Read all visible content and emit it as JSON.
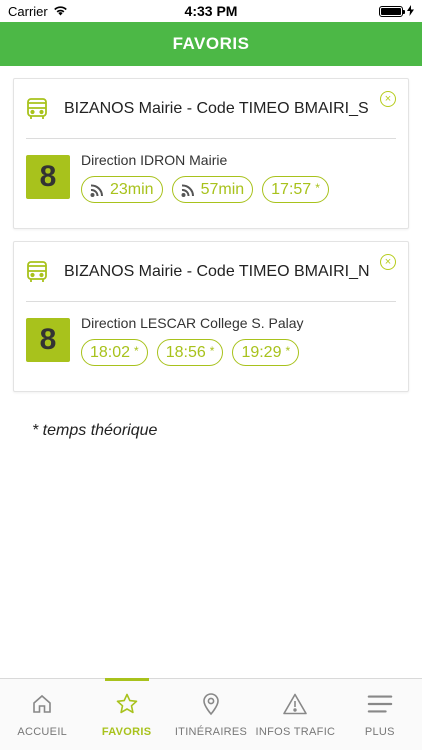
{
  "status_bar": {
    "carrier": "Carrier",
    "time": "4:33 PM",
    "battery_level": 1.0
  },
  "header": {
    "title": "FAVORIS"
  },
  "favorites": [
    {
      "stop_name": "BIZANOS Mairie - Code TIMEO BMAIRI_S",
      "line": "8",
      "direction": "Direction IDRON Mairie",
      "times": [
        {
          "text": "23min",
          "realtime": true
        },
        {
          "text": "57min",
          "realtime": true
        },
        {
          "text": "17:57",
          "realtime": false,
          "mark": "*"
        }
      ]
    },
    {
      "stop_name": "BIZANOS Mairie - Code TIMEO BMAIRI_N",
      "line": "8",
      "direction": "Direction LESCAR College S. Palay",
      "times": [
        {
          "text": "18:02",
          "realtime": false,
          "mark": "*"
        },
        {
          "text": "18:56",
          "realtime": false,
          "mark": "*"
        },
        {
          "text": "19:29",
          "realtime": false,
          "mark": "*"
        }
      ]
    }
  ],
  "footnote": "* temps théorique",
  "close_icon": "×",
  "tabs": [
    {
      "label": "ACCUEIL",
      "icon": "home-icon",
      "active": false
    },
    {
      "label": "FAVORIS",
      "icon": "star-icon",
      "active": true
    },
    {
      "label": "ITINÉRAIRES",
      "icon": "location-pin-icon",
      "active": false
    },
    {
      "label": "INFOS TRAFIC",
      "icon": "warning-icon",
      "active": false
    },
    {
      "label": "PLUS",
      "icon": "menu-icon",
      "active": false
    }
  ],
  "colors": {
    "header_green": "#4cb846",
    "accent": "#a8c21c"
  }
}
